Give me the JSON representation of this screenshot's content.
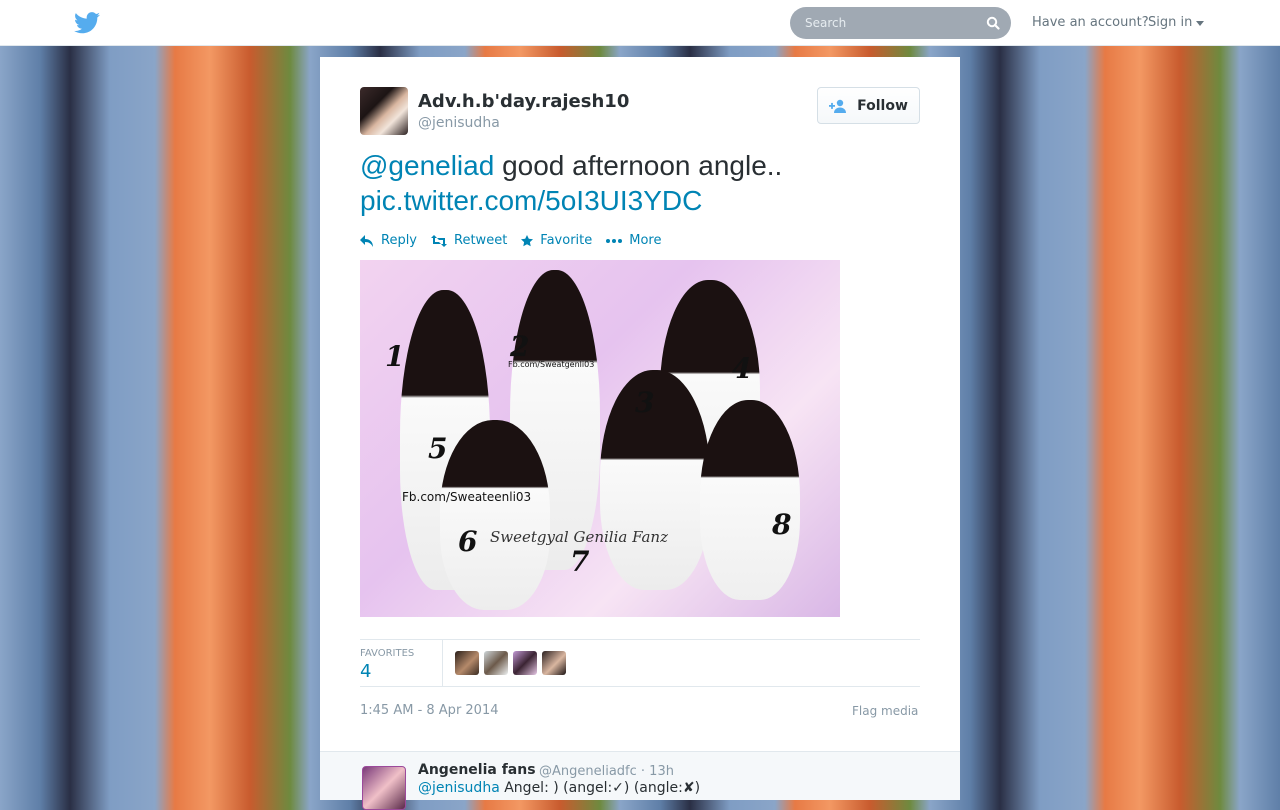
{
  "header": {
    "search_placeholder": "Search",
    "have_account": "Have an account?",
    "sign_in": "Sign in"
  },
  "tweet": {
    "name": "Adv.h.b'day.rajesh10",
    "handle": "@jenisudha",
    "follow_label": "Follow",
    "mention": "@geneliad",
    "text": " good afternoon angle..",
    "pic_link": "pic.twitter.com/5oI3UI3YDC",
    "actions": {
      "reply": "Reply",
      "retweet": "Retweet",
      "favorite": "Favorite",
      "more": "More"
    },
    "media": {
      "numbers": [
        "1",
        "2",
        "3",
        "4",
        "5",
        "6",
        "7",
        "8"
      ],
      "watermark_1": "Fb.com/Sweatgenli03",
      "watermark_2": "Fb.com/Sweateenli03",
      "signature": "Sweetgyal Genilia Fanz"
    },
    "favorites_label": "FAVORITES",
    "favorites_count": "4",
    "timestamp": "1:45 AM - 8 Apr 2014",
    "flag_media": "Flag media"
  },
  "reply": {
    "name": "Angenelia fans",
    "meta": "@Angeneliadfc · 13h",
    "mention": "@jenisudha",
    "text": " Angel: ) (angel:✓) (angle:✘)"
  },
  "colors": {
    "link": "#0084b4",
    "twitter_blue": "#55acee",
    "muted": "#8899a6"
  }
}
